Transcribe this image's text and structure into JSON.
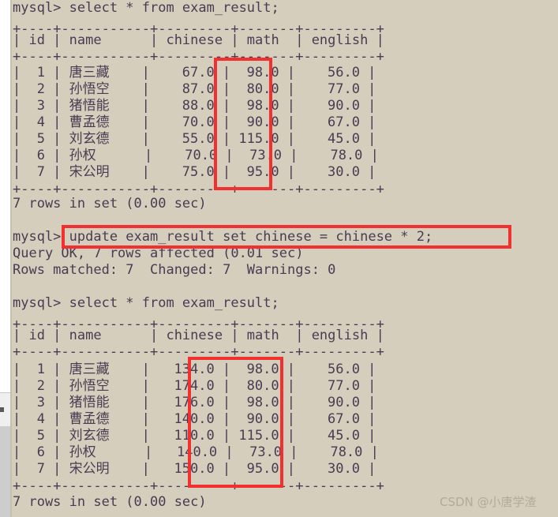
{
  "terminal": {
    "prompt": "mysql>",
    "background_color": "#d5cebc",
    "text_color": "#4a3b52",
    "highlight_color": "#f23030"
  },
  "blocks": {
    "query1": "mysql> select * from exam_result;",
    "query2": "mysql> update exam_result set chinese = chinese * 2;",
    "query3": "mysql> select * from exam_result;",
    "update_ok": "Query OK, 7 rows affected (0.01 sec)",
    "update_matched": "Rows matched: 7  Changed: 7  Warnings: 0",
    "rows_in_set_1": "7 rows in set (0.00 sec)",
    "rows_in_set_2": "7 rows in set (0.00 sec)",
    "blank": ""
  },
  "table": {
    "separator": "+----+-----------+---------+-------+---------+",
    "header_row": "| id | name      | chinese | math  | english |",
    "columns": [
      "id",
      "name",
      "chinese",
      "math",
      "english"
    ]
  },
  "result_before": {
    "rows": [
      "|  1 | 唐三藏    |    67.0 |  98.0 |    56.0 |",
      "|  2 | 孙悟空    |    87.0 |  80.0 |    77.0 |",
      "|  3 | 猪悟能    |    88.0 |  98.0 |    90.0 |",
      "|  4 | 曹孟德    |    70.0 |  90.0 |    67.0 |",
      "|  5 | 刘玄德    |    55.0 | 115.0 |    45.0 |",
      "|  6 | 孙权      |    70.0 |  73.0 |    78.0 |",
      "|  7 | 宋公明    |    75.0 |  95.0 |    30.0 |"
    ],
    "data": [
      {
        "id": "1",
        "name": "唐三藏",
        "chinese": "67.0",
        "math": "98.0",
        "english": "56.0"
      },
      {
        "id": "2",
        "name": "孙悟空",
        "chinese": "87.0",
        "math": "80.0",
        "english": "77.0"
      },
      {
        "id": "3",
        "name": "猪悟能",
        "chinese": "88.0",
        "math": "98.0",
        "english": "90.0"
      },
      {
        "id": "4",
        "name": "曹孟德",
        "chinese": "70.0",
        "math": "90.0",
        "english": "67.0"
      },
      {
        "id": "5",
        "name": "刘玄德",
        "chinese": "55.0",
        "math": "115.0",
        "english": "45.0"
      },
      {
        "id": "6",
        "name": "孙权",
        "chinese": "70.0",
        "math": "73.0",
        "english": "78.0"
      },
      {
        "id": "7",
        "name": "宋公明",
        "chinese": "75.0",
        "math": "95.0",
        "english": "30.0"
      }
    ]
  },
  "result_after": {
    "rows": [
      "|  1 | 唐三藏    |   134.0 |  98.0 |    56.0 |",
      "|  2 | 孙悟空    |   174.0 |  80.0 |    77.0 |",
      "|  3 | 猪悟能    |   176.0 |  98.0 |    90.0 |",
      "|  4 | 曹孟德    |   140.0 |  90.0 |    67.0 |",
      "|  5 | 刘玄德    |   110.0 | 115.0 |    45.0 |",
      "|  6 | 孙权      |   140.0 |  73.0 |    78.0 |",
      "|  7 | 宋公明    |   150.0 |  95.0 |    30.0 |"
    ],
    "data": [
      {
        "id": "1",
        "name": "唐三藏",
        "chinese": "134.0",
        "math": "98.0",
        "english": "56.0"
      },
      {
        "id": "2",
        "name": "孙悟空",
        "chinese": "174.0",
        "math": "80.0",
        "english": "77.0"
      },
      {
        "id": "3",
        "name": "猪悟能",
        "chinese": "176.0",
        "math": "98.0",
        "english": "90.0"
      },
      {
        "id": "4",
        "name": "曹孟德",
        "chinese": "140.0",
        "math": "90.0",
        "english": "67.0"
      },
      {
        "id": "5",
        "name": "刘玄德",
        "chinese": "110.0",
        "math": "115.0",
        "english": "45.0"
      },
      {
        "id": "6",
        "name": "孙权",
        "chinese": "140.0",
        "math": "73.0",
        "english": "78.0"
      },
      {
        "id": "7",
        "name": "宋公明",
        "chinese": "150.0",
        "math": "95.0",
        "english": "30.0"
      }
    ]
  },
  "watermark": {
    "text": "CSDN @小唐学渣"
  }
}
